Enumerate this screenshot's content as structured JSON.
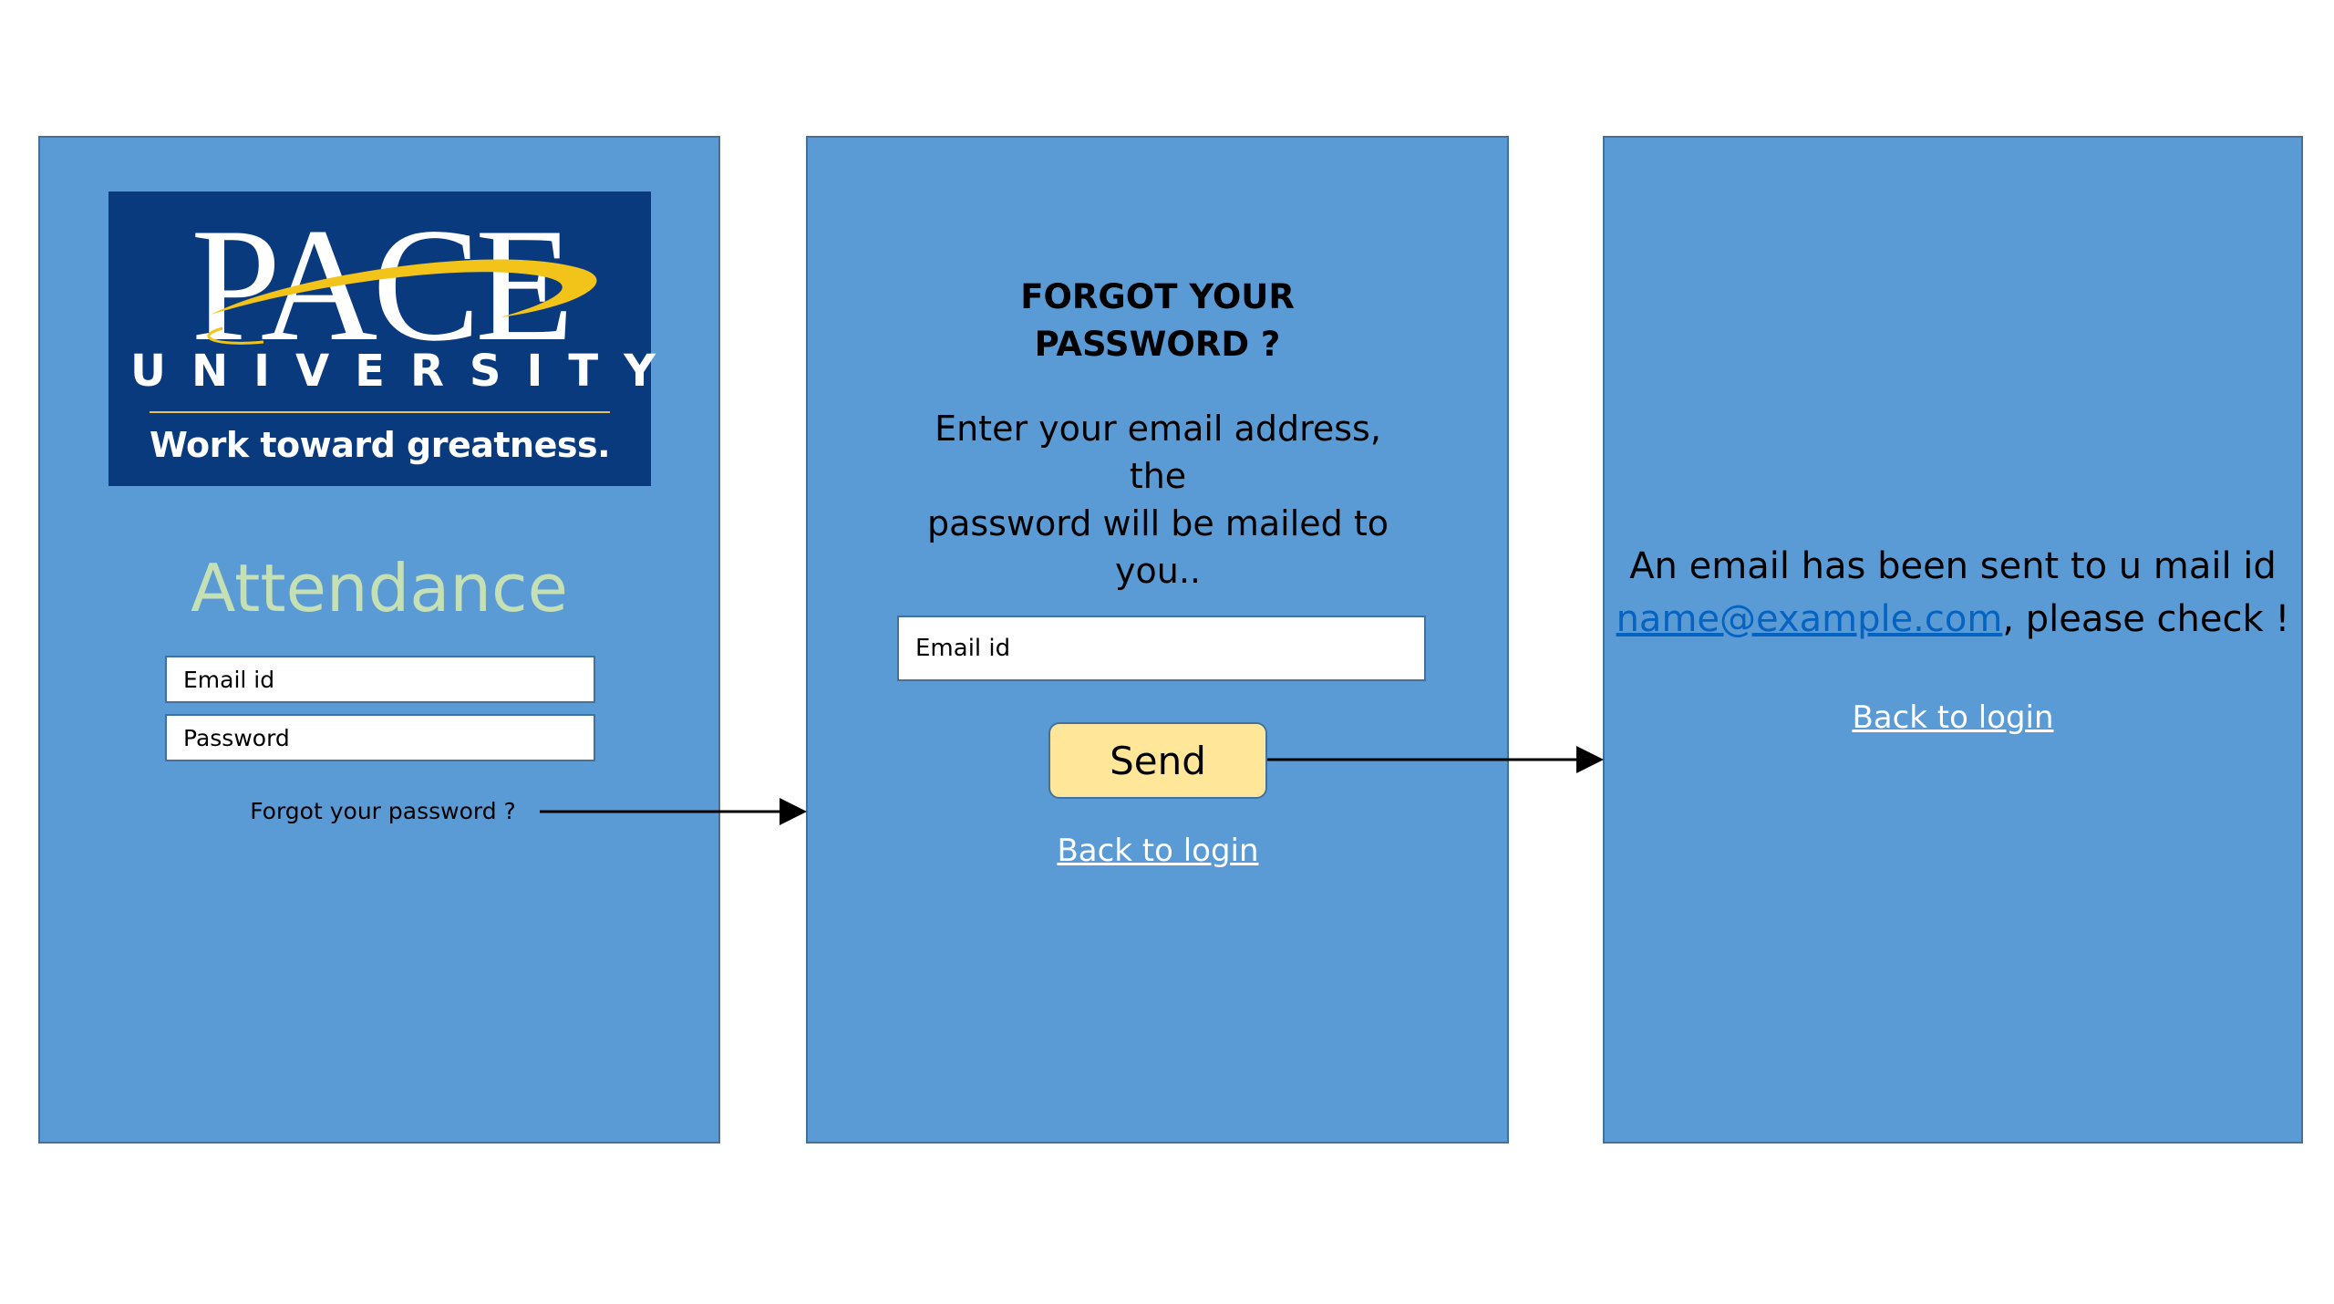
{
  "login_screen": {
    "logo": {
      "brand": "PACE",
      "university": "UNIVERSITY",
      "tagline": "Work toward greatness."
    },
    "app_title": "Attendance",
    "email_placeholder": "Email id",
    "password_placeholder": "Password",
    "forgot_link": "Forgot your password ?"
  },
  "forgot_screen": {
    "title_line1": "FORGOT YOUR",
    "title_line2": "PASSWORD ?",
    "instructions_line1": "Enter your email address, the",
    "instructions_line2": "password will be mailed to",
    "instructions_line3": "you..",
    "email_placeholder": "Email id",
    "send_button": "Send",
    "back_link": "Back to login"
  },
  "sent_screen": {
    "message_part1": "An email has been sent to u mail id",
    "email": "name@example.com",
    "message_part2": ", please check !",
    "back_link": "Back to login"
  },
  "colors": {
    "panel_fill": "#5b9bd5",
    "panel_border": "#41719c",
    "logo_bg": "#0a3a7e",
    "logo_swoosh": "#f2c318",
    "title_green": "#c5e0b4",
    "send_button_fill": "#ffe699",
    "email_link": "#0563c1"
  }
}
